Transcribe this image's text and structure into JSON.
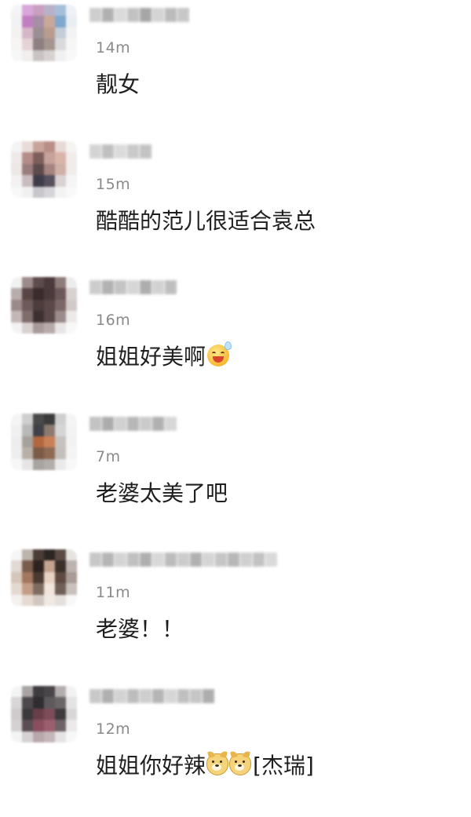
{
  "comments": [
    {
      "time": "14m",
      "text": "靓女",
      "avatar_colors": [
        "#f4f3f6",
        "#d9a7d9",
        "#c99fc0",
        "#b7b1c8",
        "#a6bfd8",
        "#eef2f6",
        "#f2f1f4",
        "#c17fc1",
        "#a58fa5",
        "#c9a89a",
        "#7fa8cc",
        "#e9eef3",
        "#f4f2f1",
        "#d6b7c7",
        "#9c8f93",
        "#b99c8d",
        "#c4cdd8",
        "#f3f3f3",
        "#f6f5f4",
        "#e5d3d5",
        "#8d7f82",
        "#a4968f",
        "#dad9dc",
        "#f6f6f6",
        "#f7f7f7",
        "#f2eeee",
        "#c9c4c4",
        "#d7d2d0",
        "#f1f1f1",
        "#f8f8f8"
      ],
      "name_colors": [
        "#c9c9c9",
        "#a9a9a9",
        "#d6d6d6",
        "#bcbcbc",
        "#9d9d9d",
        "#d0d0d0",
        "#b4b4b4",
        "#c2c2c2"
      ]
    },
    {
      "time": "15m",
      "text": "酷酷的范儿很适合袁总",
      "avatar_colors": [
        "#f5f4f4",
        "#e9dcd8",
        "#c9a49a",
        "#b98e86",
        "#e6d9d6",
        "#f5f4f3",
        "#efe9e8",
        "#b58d8a",
        "#7e5e5a",
        "#c7a29b",
        "#d9b4a9",
        "#f1ecea",
        "#ede7e6",
        "#9a7d7c",
        "#5d4a4c",
        "#a68380",
        "#cfb0a6",
        "#f0ece9",
        "#f3f1f1",
        "#c9bcbf",
        "#3f3c4a",
        "#57505e",
        "#dad2d3",
        "#f6f5f5",
        "#f8f8f8",
        "#f1f0f1",
        "#c8c6cc",
        "#d6d4d8",
        "#f3f3f3",
        "#f9f9f9"
      ],
      "name_colors": [
        "#cfcfcf",
        "#b9b9b9",
        "#d8d8d8",
        "#c4c4c4",
        "#bdbdbd"
      ]
    },
    {
      "time": "16m",
      "text": "姐姐好美啊",
      "emoji": "laugh-sweat",
      "avatar_colors": [
        "#f2f1f1",
        "#9c8b8a",
        "#5e4b4c",
        "#4a3a3b",
        "#8e7c7b",
        "#eeeded",
        "#b9adac",
        "#5a4546",
        "#3a2c2d",
        "#4b3a3b",
        "#6b5858",
        "#d8d1d0",
        "#9a8a88",
        "#6e5a59",
        "#4d3c3c",
        "#5a4747",
        "#7a6766",
        "#d2cac9",
        "#c3b8b7",
        "#7f6d6c",
        "#3e3031",
        "#5b4949",
        "#9b8b8a",
        "#ece9e9",
        "#f4f3f3",
        "#d9d2d1",
        "#a89a99",
        "#b7abaa",
        "#e9e5e5",
        "#f8f8f8"
      ],
      "name_colors": [
        "#c7c7c7",
        "#aaaaaa",
        "#bebebe",
        "#d2d2d2",
        "#a5a5a5",
        "#cdcdcd",
        "#b8b8b8"
      ]
    },
    {
      "time": "7m",
      "text": "老婆太美了吧",
      "avatar_colors": [
        "#f4f4f4",
        "#cfcfcf",
        "#4a4a4a",
        "#3b3b3b",
        "#cfcfcf",
        "#f4f4f4",
        "#f0f0f0",
        "#b9b9b9",
        "#3f4146",
        "#8c7a6e",
        "#d5d5d5",
        "#f3f3f3",
        "#ededed",
        "#a7a19b",
        "#b3673f",
        "#c98058",
        "#c7c2bd",
        "#f2f2f2",
        "#eeeeee",
        "#b8b0a8",
        "#7b5a47",
        "#8e6a55",
        "#c4c0bb",
        "#f4f4f4",
        "#f7f7f7",
        "#e8e6e4",
        "#a8a4a0",
        "#b2aea9",
        "#ebeaea",
        "#f8f8f8"
      ],
      "name_colors": [
        "#bcbcbc",
        "#a4a4a4",
        "#cbcbcb",
        "#b0b0b0",
        "#c5c5c5",
        "#a9a9a9",
        "#d3d3d3"
      ]
    },
    {
      "time": "11m",
      "text": "老婆！！",
      "avatar_colors": [
        "#f6f6f6",
        "#bdb3ad",
        "#4b3c36",
        "#2c2523",
        "#5a4b45",
        "#e7e4e2",
        "#e1d9d3",
        "#7a5d4d",
        "#2f2320",
        "#c4a38f",
        "#3b2f2b",
        "#bcb3ae",
        "#d6c5b9",
        "#a3765e",
        "#4a3a32",
        "#e8d2c2",
        "#5e4a40",
        "#a89c95",
        "#e4d9d1",
        "#c49e86",
        "#7e6b61",
        "#f1e5dc",
        "#6f5f57",
        "#c8c0bb",
        "#f4f1ef",
        "#e6dbd3",
        "#d2c7c0",
        "#efe8e3",
        "#e4e0dd",
        "#f8f8f8"
      ],
      "name_colors": [
        "#c1c1c1",
        "#adadad",
        "#cfcfcf",
        "#bababa",
        "#a7a7a7",
        "#d4d4d4",
        "#b5b5b5",
        "#c7c7c7",
        "#a9a9a9",
        "#d1d1d1",
        "#bfbfbf",
        "#b0b0b0",
        "#cacaca",
        "#bcbcbc",
        "#d6d6d6"
      ]
    },
    {
      "time": "12m",
      "text": "姐姐你好辣",
      "suffix": "[杰瑞]",
      "dogs": 2,
      "avatar_colors": [
        "#f4f4f4",
        "#a9a3a4",
        "#3f3c40",
        "#4a4548",
        "#b4adae",
        "#f2f2f2",
        "#d9d6d7",
        "#4d484c",
        "#2f2d31",
        "#5e595c",
        "#6b6568",
        "#e5e3e4",
        "#cfcbcc",
        "#3c393d",
        "#6a3f4a",
        "#7c4c58",
        "#3d3a3e",
        "#d9d6d7",
        "#d5d1d2",
        "#5a4e52",
        "#8a4e5f",
        "#9b5e6e",
        "#6d6366",
        "#ebe9ea",
        "#f4f3f3",
        "#d6d2d3",
        "#b8a7ab",
        "#c4b6b9",
        "#e6e3e4",
        "#f8f8f8"
      ],
      "name_colors": [
        "#c3c3c3",
        "#a8a8a8",
        "#cecece",
        "#b6b6b6",
        "#c9c9c9",
        "#adadad",
        "#d2d2d2",
        "#bababa",
        "#c0c0c0",
        "#a6a6a6"
      ]
    }
  ]
}
